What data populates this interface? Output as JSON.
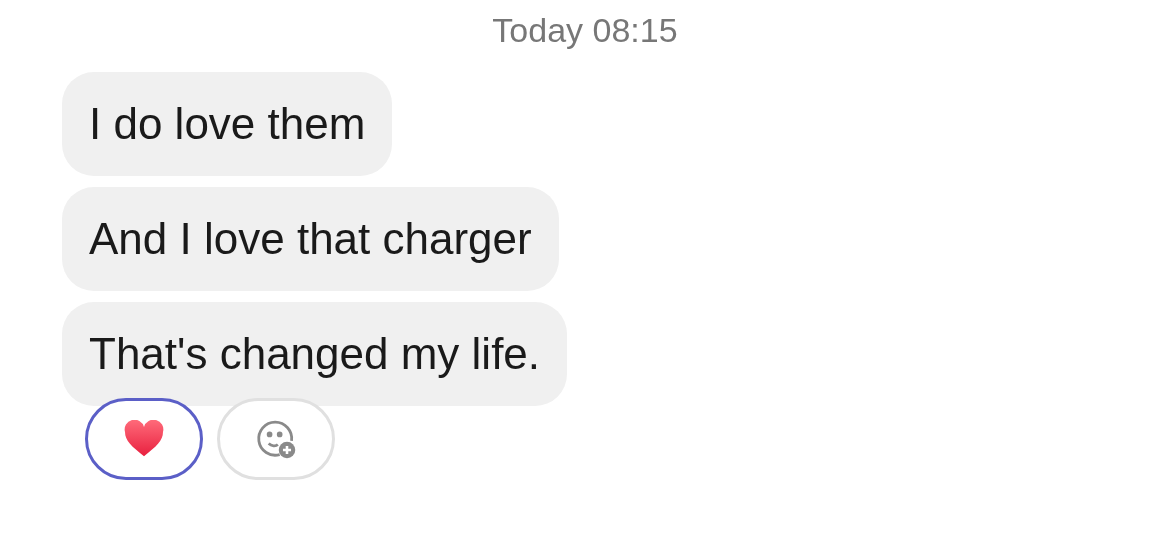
{
  "timestamp": "Today 08:15",
  "messages": [
    {
      "text": "I do love them"
    },
    {
      "text": "And I love that charger"
    },
    {
      "text": "That's changed my life."
    }
  ],
  "reactions": [
    {
      "kind": "heart",
      "selected": true
    },
    {
      "kind": "add",
      "selected": false
    }
  ]
}
